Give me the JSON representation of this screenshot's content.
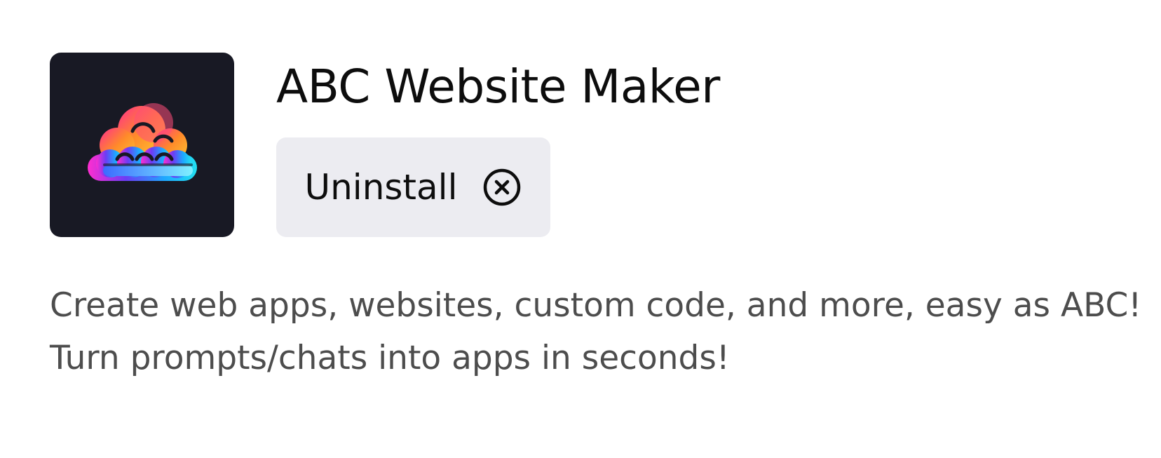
{
  "app": {
    "title": "ABC Website Maker",
    "icon": {
      "name": "cloud-logo-icon",
      "background_color": "#181924",
      "gradient_colors": [
        "#ff2d8e",
        "#ff8a2a",
        "#ffc531",
        "#6b3cf5",
        "#1ea7ff",
        "#22e0f0"
      ]
    }
  },
  "actions": {
    "uninstall_label": "Uninstall",
    "uninstall_icon": "close-circle-icon",
    "button_background": "#ececf1"
  },
  "description": {
    "lines": [
      "Create web apps, websites, custom code, and more, easy as ABC!",
      "Turn prompts/chats into apps in seconds!"
    ]
  },
  "colors": {
    "title_text": "#0d0d0d",
    "button_text": "#0d0d0d",
    "description_text": "#4d4d4d",
    "page_background": "#ffffff"
  }
}
